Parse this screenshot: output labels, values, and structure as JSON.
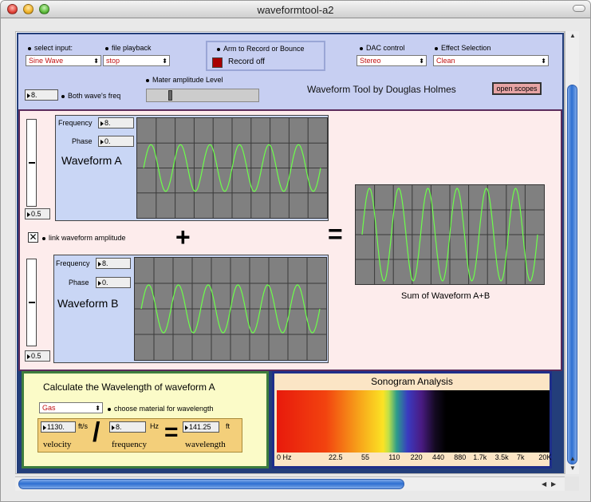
{
  "window": {
    "title": "waveformtool-a2"
  },
  "top": {
    "select_input_label": "select input:",
    "select_input_value": "Sine Wave",
    "file_playback_label": "file playback",
    "file_playback_value": "stop",
    "arm_label": "Arm to Record or Bounce",
    "record_status": "Record off",
    "dac_label": "DAC control",
    "dac_value": "Stereo",
    "effect_label": "Effect Selection",
    "effect_value": "Clean",
    "master_label": "Mater amplitude Level",
    "master_level": 0.2,
    "freq_value": "8.",
    "freq_label": "Both wave's freq",
    "app_title": "Waveform Tool by Douglas Holmes",
    "open_scopes": "open scopes"
  },
  "wave_a": {
    "freq_label": "Frequency",
    "freq_value": "8.",
    "phase_label": "Phase",
    "phase_value": "0.",
    "name": "Waveform A",
    "amp_value": "0.5",
    "amplitude": 0.5,
    "cycles": 6
  },
  "wave_b": {
    "freq_label": "Frequency",
    "freq_value": "8.",
    "phase_label": "Phase",
    "phase_value": "0.",
    "name": "Waveform B",
    "amp_value": "0.5",
    "amplitude": 0.5,
    "cycles": 6
  },
  "link": {
    "checked_mark": "✕",
    "label": "link waveform amplitude"
  },
  "symbols": {
    "plus": "+",
    "equals": "="
  },
  "sum": {
    "label": "Sum of Waveform A+B",
    "amplitude": 1.0,
    "cycles": 6
  },
  "calc": {
    "title": "Calculate the Wavelength of waveform A",
    "material_value": "Gas",
    "material_label": "choose material for wavelength",
    "velocity_value": "1130.",
    "velocity_unit": "ft/s",
    "frequency_value": "8.",
    "frequency_unit": "Hz",
    "wavelength_value": "141.25",
    "wavelength_unit": "ft",
    "velocity_label": "velocity",
    "frequency_label": "frequency",
    "wavelength_label": "wavelength",
    "divide": "/",
    "equals": "="
  },
  "sonogram": {
    "title": "Sonogram Analysis",
    "axis_labels": [
      "0 Hz",
      "22.5",
      "55",
      "110",
      "220",
      "440",
      "880",
      "1.7k",
      "3.5k",
      "7k",
      "20K"
    ]
  },
  "colors": {
    "waveform": "#6cff4a",
    "scope_bg": "#808080",
    "accent": "#233e7a"
  }
}
